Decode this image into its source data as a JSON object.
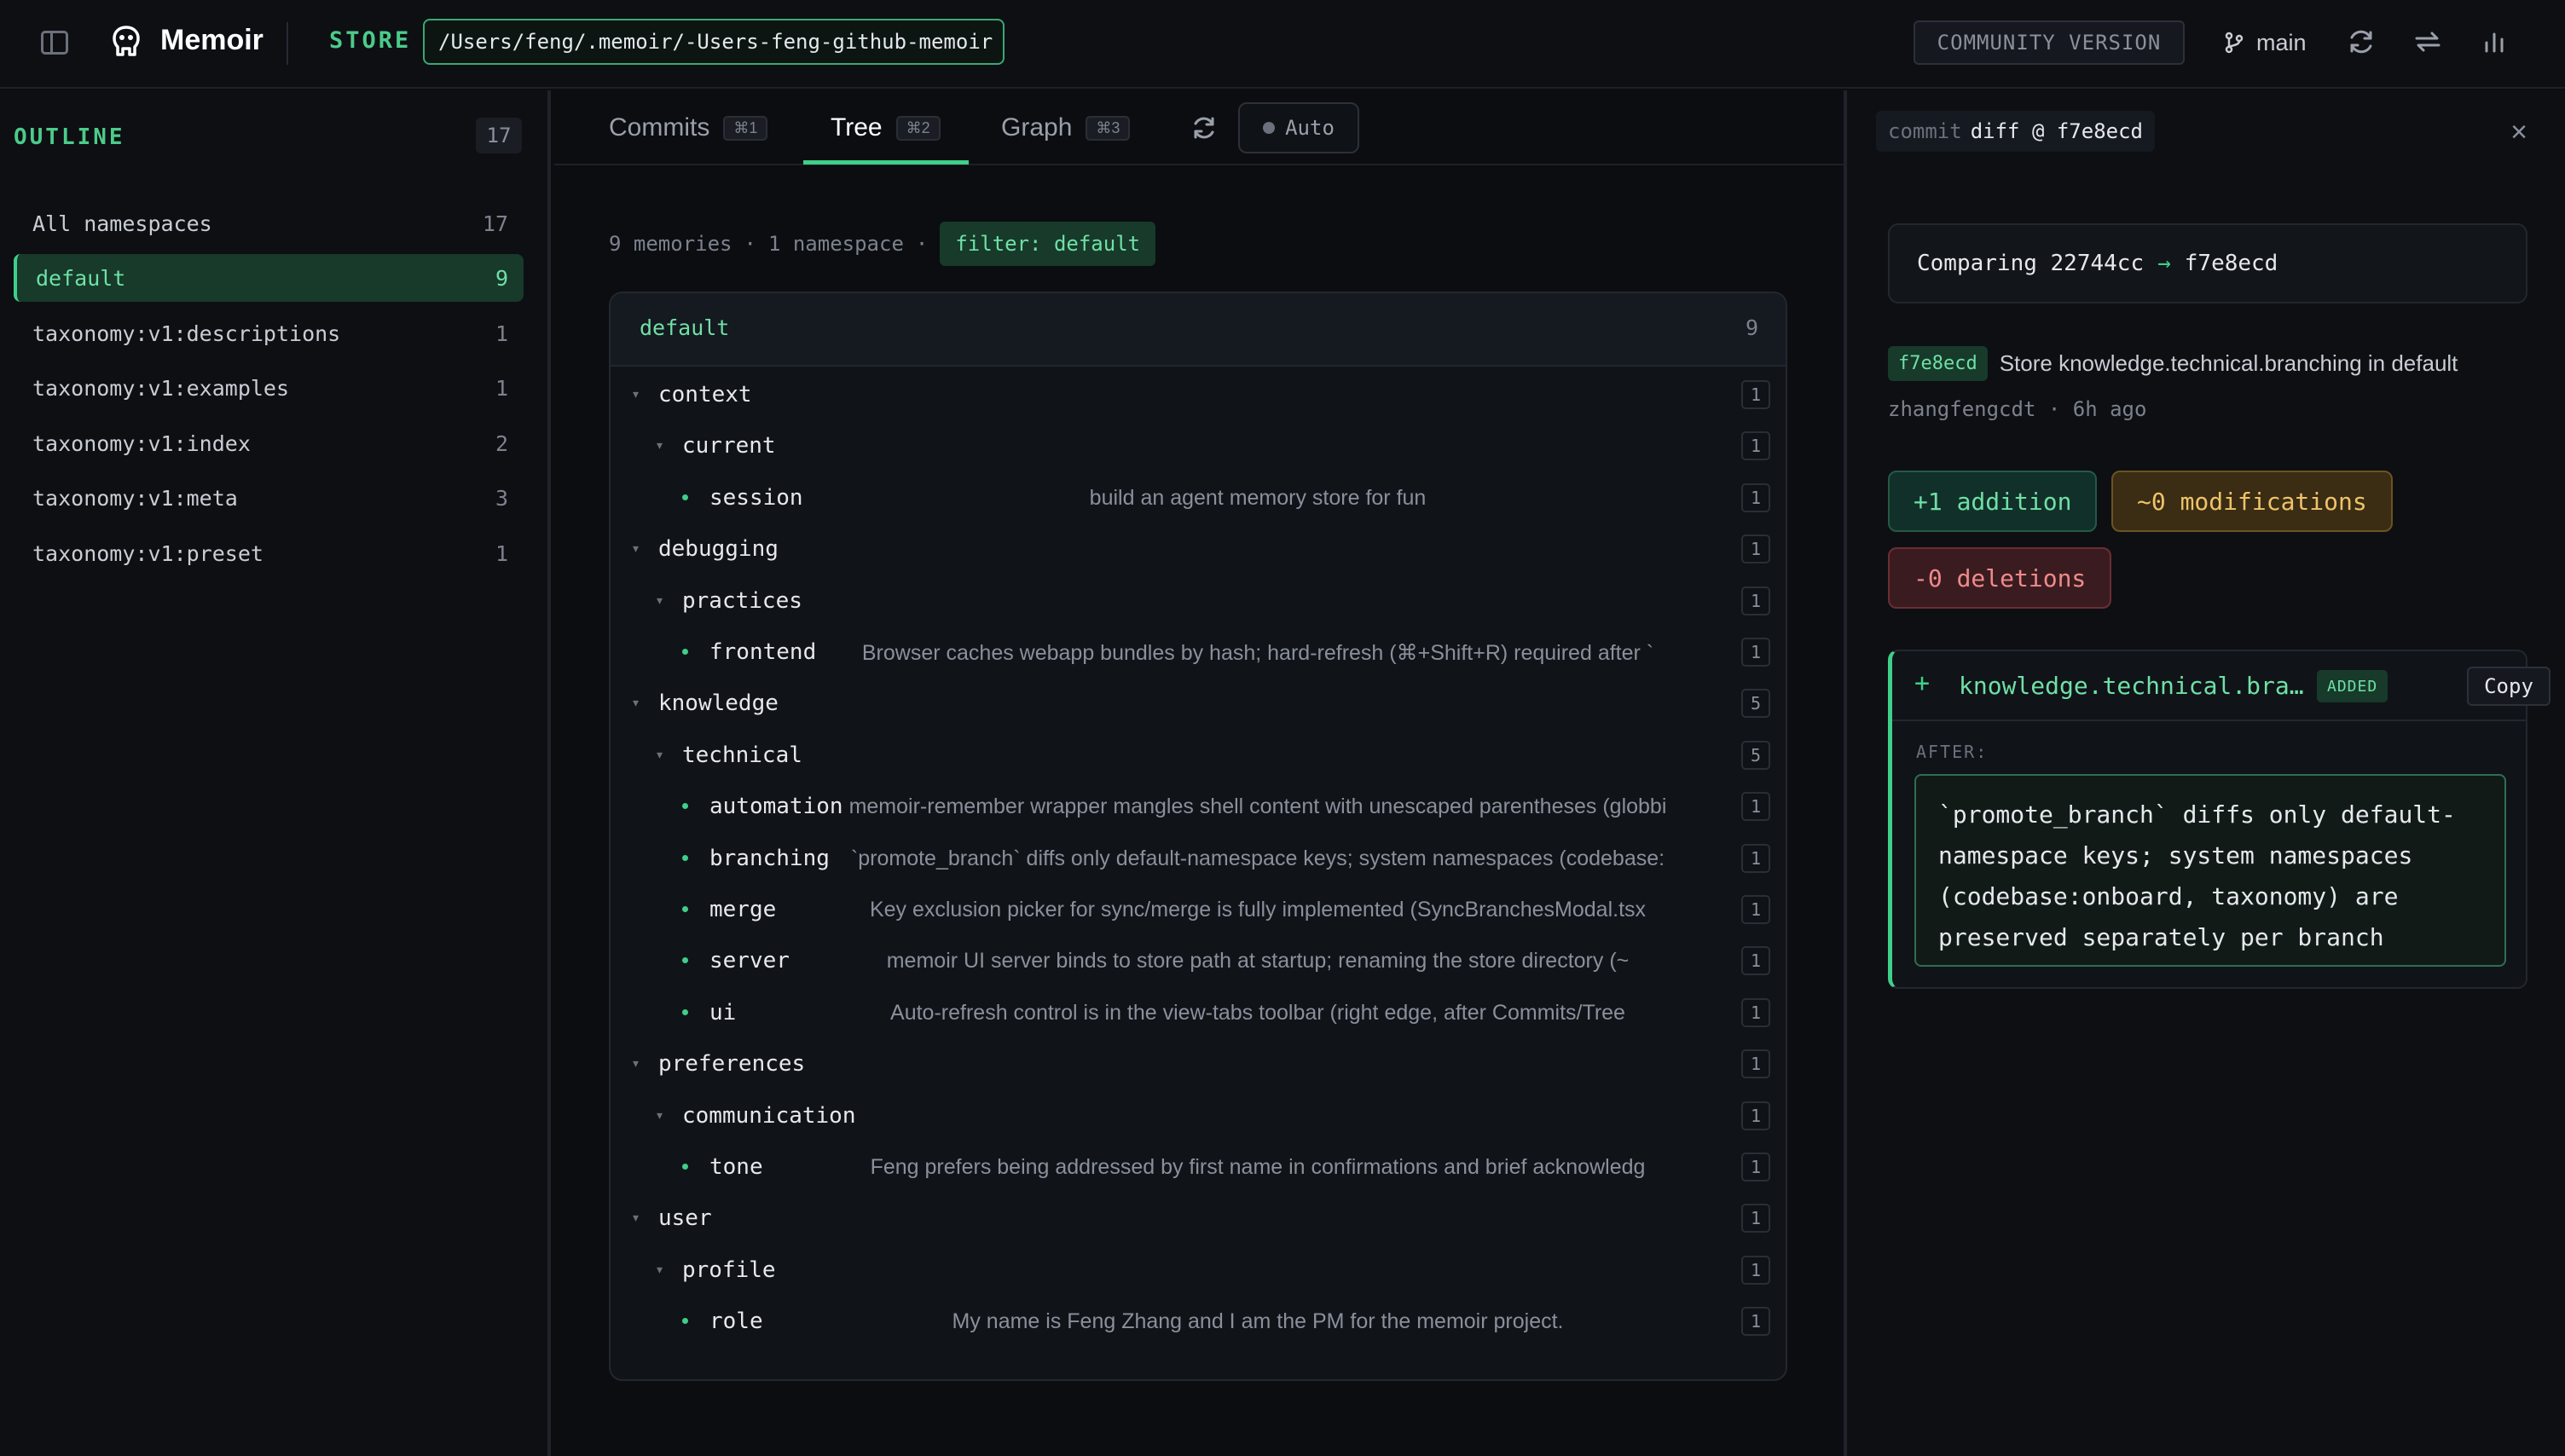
{
  "header": {
    "app_name": "Memoir",
    "store_label": "STORE",
    "store_path": "/Users/feng/.memoir/-Users-feng-github-memoir",
    "community_badge": "COMMUNITY VERSION",
    "branch": "main",
    "icons": [
      "sidebar-toggle-icon",
      "memoir-logo-icon",
      "git-branch-icon",
      "refresh-icon",
      "sync-icon",
      "stats-icon"
    ]
  },
  "sidebar": {
    "title": "OUTLINE",
    "total": "17",
    "items": [
      {
        "label": "All namespaces",
        "count": "17",
        "active": false
      },
      {
        "label": "default",
        "count": "9",
        "active": true
      },
      {
        "label": "taxonomy:v1:descriptions",
        "count": "1",
        "active": false
      },
      {
        "label": "taxonomy:v1:examples",
        "count": "1",
        "active": false
      },
      {
        "label": "taxonomy:v1:index",
        "count": "2",
        "active": false
      },
      {
        "label": "taxonomy:v1:meta",
        "count": "3",
        "active": false
      },
      {
        "label": "taxonomy:v1:preset",
        "count": "1",
        "active": false
      }
    ]
  },
  "center": {
    "tabs": [
      {
        "label": "Commits",
        "shortcut": "⌘1"
      },
      {
        "label": "Tree",
        "shortcut": "⌘2",
        "active": true
      },
      {
        "label": "Graph",
        "shortcut": "⌘3"
      }
    ],
    "auto_label": "Auto",
    "summary": {
      "memories": "9 memories",
      "namespaces": "1 namespace",
      "sep": "·",
      "filter": "filter: default"
    },
    "tree": {
      "title": "default",
      "count": "9",
      "rows": [
        {
          "label": "context",
          "level": 0,
          "type": "folder",
          "count": "1",
          "desc": ""
        },
        {
          "label": "current",
          "level": 1,
          "type": "folder",
          "count": "1",
          "desc": ""
        },
        {
          "label": "session",
          "level": 2,
          "type": "leaf",
          "count": "1",
          "desc": "build an agent memory store for fun"
        },
        {
          "label": "debugging",
          "level": 0,
          "type": "folder",
          "count": "1",
          "desc": ""
        },
        {
          "label": "practices",
          "level": 1,
          "type": "folder",
          "count": "1",
          "desc": ""
        },
        {
          "label": "frontend",
          "level": 2,
          "type": "leaf",
          "count": "1",
          "desc": "Browser caches webapp bundles by hash; hard-refresh (⌘+Shift+R) required after `"
        },
        {
          "label": "knowledge",
          "level": 0,
          "type": "folder",
          "count": "5",
          "desc": ""
        },
        {
          "label": "technical",
          "level": 1,
          "type": "folder",
          "count": "5",
          "desc": ""
        },
        {
          "label": "automation",
          "level": 2,
          "type": "leaf",
          "count": "1",
          "desc": "memoir-remember wrapper mangles shell content with unescaped parentheses (globbi"
        },
        {
          "label": "branching",
          "level": 2,
          "type": "leaf",
          "count": "1",
          "desc": "`promote_branch` diffs only default-namespace keys; system namespaces (codebase:"
        },
        {
          "label": "merge",
          "level": 2,
          "type": "leaf",
          "count": "1",
          "desc": "Key exclusion picker for sync/merge is fully implemented (SyncBranchesModal.tsx"
        },
        {
          "label": "server",
          "level": 2,
          "type": "leaf",
          "count": "1",
          "desc": "memoir UI server binds to store path at startup; renaming the store directory (~"
        },
        {
          "label": "ui",
          "level": 2,
          "type": "leaf",
          "count": "1",
          "desc": "Auto-refresh control is in the view-tabs toolbar (right edge, after Commits/Tree"
        },
        {
          "label": "preferences",
          "level": 0,
          "type": "folder",
          "count": "1",
          "desc": ""
        },
        {
          "label": "communication",
          "level": 1,
          "type": "folder",
          "count": "1",
          "desc": ""
        },
        {
          "label": "tone",
          "level": 2,
          "type": "leaf",
          "count": "1",
          "desc": "Feng prefers being addressed by first name in confirmations and brief acknowledg"
        },
        {
          "label": "user",
          "level": 0,
          "type": "folder",
          "count": "1",
          "desc": ""
        },
        {
          "label": "profile",
          "level": 1,
          "type": "folder",
          "count": "1",
          "desc": ""
        },
        {
          "label": "role",
          "level": 2,
          "type": "leaf",
          "count": "1",
          "desc": "My name is Feng Zhang and I am the PM for the memoir project."
        }
      ]
    }
  },
  "right": {
    "diff_prefix": "commit",
    "diff_title": "diff @ f7e8ecd",
    "close": "×",
    "compare_prefix": "Comparing 22744cc",
    "compare_arrow": "→",
    "compare_to": "f7e8ecd",
    "commit_hash": "f7e8ecd",
    "commit_message": "Store knowledge.technical.branching in default",
    "commit_meta": "zhangfengcdt · 6h ago",
    "additions": "+1 addition",
    "modifications": "~0 modifications",
    "deletions": "-0 deletions",
    "change": {
      "plus": "+",
      "key": "knowledge.technical.branching",
      "badge": "ADDED",
      "copy": "Copy",
      "after_label": "AFTER:",
      "after_text": "`promote_branch` diffs only default-namespace keys; system namespaces (codebase:onboard, taxonomy) are preserved separately per branch"
    }
  }
}
